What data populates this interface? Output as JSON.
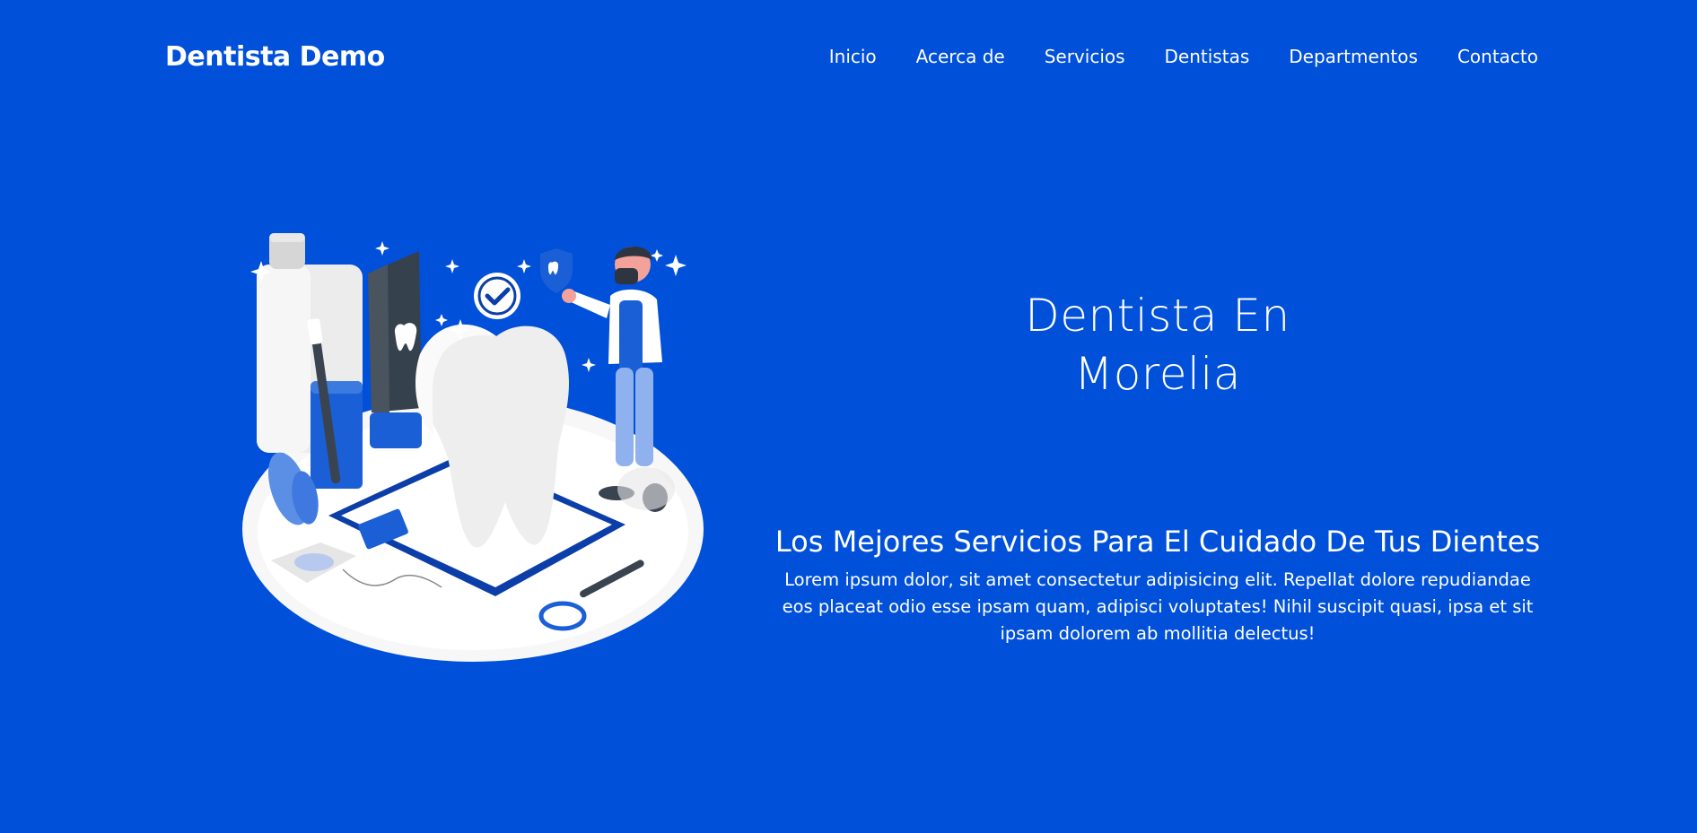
{
  "brand": {
    "name": "Dentista Demo"
  },
  "nav": {
    "items": [
      {
        "label": "Inicio"
      },
      {
        "label": "Acerca de"
      },
      {
        "label": "Servicios"
      },
      {
        "label": "Dentistas"
      },
      {
        "label": "Departmentos"
      },
      {
        "label": "Contacto"
      }
    ]
  },
  "hero": {
    "title_line1": "Dentista En",
    "title_line2": "Morelia",
    "subtitle": "Los Mejores Servicios Para El Cuidado De Tus Dientes",
    "description": "Lorem ipsum dolor, sit amet consectetur adipisicing elit. Repellat dolore repudiandae eos placeat odio esse ipsam quam, adipisci voluptates! Nihil suscipit quasi, ipsa et sit ipsam dolorem ab mollitia delectus!",
    "illustration": "dentist-tooth-illustration"
  },
  "colors": {
    "background": "#0050d9",
    "text": "#ffffff",
    "accent_dark": "#1c3fa8",
    "light_gray": "#f4f4f4"
  }
}
